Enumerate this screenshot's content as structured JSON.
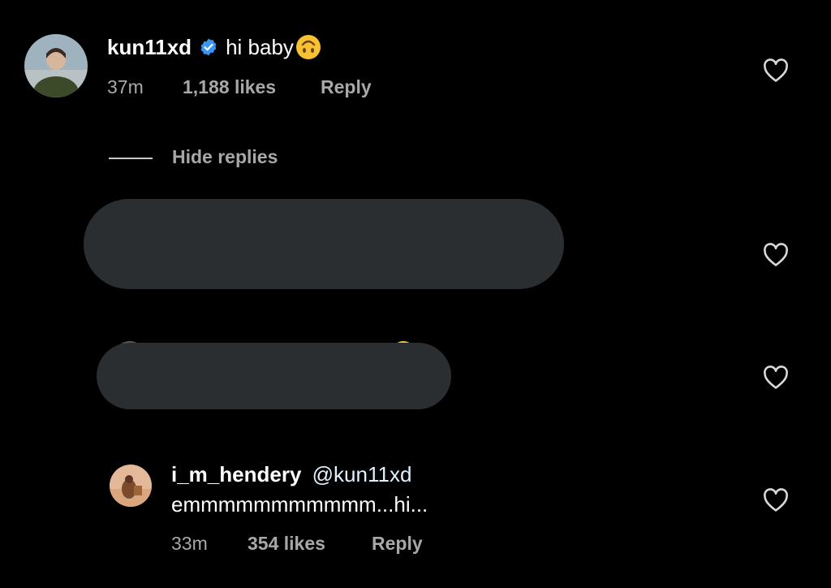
{
  "comment": {
    "username": "kun11xd",
    "verified": true,
    "text": "hi baby",
    "emoji": "🙃",
    "time": "37m",
    "likes": "1,188 likes",
    "reply_label": "Reply"
  },
  "replies_toggle": {
    "label": "Hide replies"
  },
  "reply": {
    "username": "i_m_hendery",
    "mention": "@kun11xd",
    "text": "emmmmmmmmmmm...hi...",
    "time": "33m",
    "likes": "354 likes",
    "reply_label": "Reply"
  },
  "colors": {
    "background": "#000000",
    "meta_text": "#a8a8a8",
    "verified_badge": "#3897f0",
    "redaction": "#2b2e31",
    "mention": "#e0f1ff"
  },
  "icons": [
    "verified-badge-icon",
    "heart-outline-icon"
  ]
}
